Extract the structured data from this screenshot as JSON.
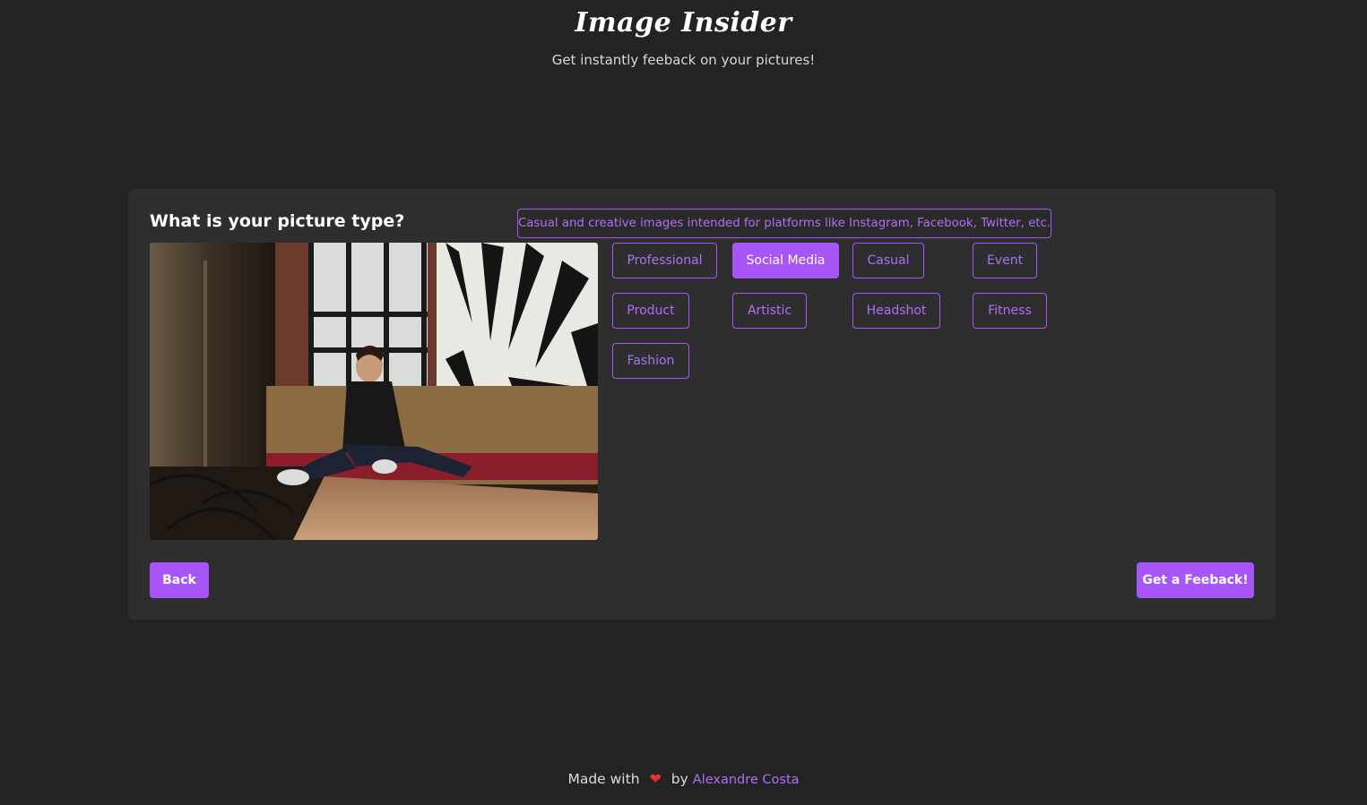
{
  "header": {
    "title": "Image Insider",
    "subtitle": "Get instantly feeback on your pictures!"
  },
  "card": {
    "heading": "What is your picture type?",
    "tooltip": "Casual and creative images intended for platforms like Instagram, Facebook, Twitter, etc.",
    "picture_types": [
      "Professional",
      "Social Media",
      "Casual",
      "Event",
      "Product",
      "Artistic",
      "Headshot",
      "Fitness",
      "Fashion"
    ],
    "selected_type": "Social Media",
    "back_label": "Back",
    "submit_label": "Get a Feeback!"
  },
  "footer": {
    "made_with": "Made with",
    "by": "by",
    "author": "Alexandre Costa"
  },
  "colors": {
    "accent": "#a855f7",
    "background": "#232323",
    "card": "#2e2e2e",
    "heart": "#e5322d"
  },
  "icons": {
    "heart": "heart-icon"
  }
}
